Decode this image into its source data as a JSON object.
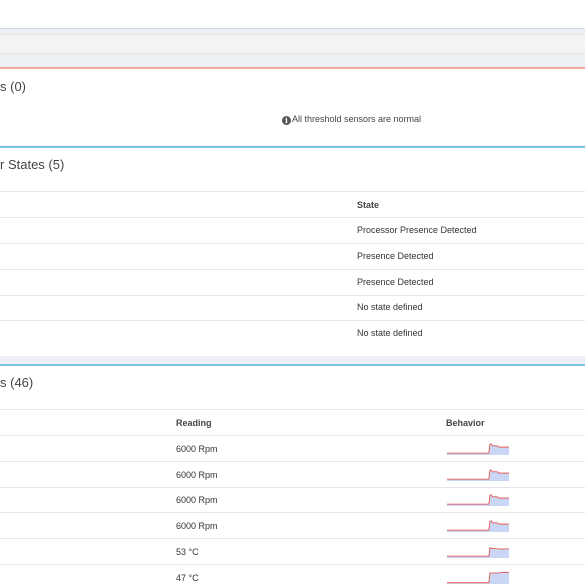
{
  "threshold_panel": {
    "title": "s (0)",
    "message": "All threshold sensors are normal"
  },
  "discrete_panel": {
    "title": "r States (5)",
    "columns": {
      "state": "State"
    },
    "rows": [
      {
        "state": "Processor Presence Detected"
      },
      {
        "state": "Presence Detected"
      },
      {
        "state": "Presence Detected"
      },
      {
        "state": "No state defined"
      },
      {
        "state": "No state defined"
      }
    ]
  },
  "sensor_panel": {
    "title": "s (46)",
    "columns": {
      "reading": "Reading",
      "behavior": "Behavior"
    },
    "rows": [
      {
        "reading": "6000 Rpm",
        "behavior": [
          0.15,
          0.15,
          0.15,
          0.15,
          0.15,
          0.15,
          0.15,
          0.15,
          0.15,
          0.15,
          0.15,
          0.15,
          0.15,
          0.15,
          0.15,
          0.15,
          0.15,
          0.15,
          0.15,
          0.15,
          0.15,
          0.15,
          0.15,
          0.15,
          0.15,
          0.15,
          0.15,
          0.15,
          0.15,
          0.15,
          0.15,
          0.15,
          0.15,
          0.15,
          0.85,
          0.85,
          0.7,
          0.7,
          0.72,
          0.7,
          0.7,
          0.6,
          0.62,
          0.6,
          0.6,
          0.62,
          0.6,
          0.6,
          0.62,
          0.6
        ]
      },
      {
        "reading": "6000 Rpm",
        "behavior": [
          0.15,
          0.15,
          0.15,
          0.15,
          0.15,
          0.15,
          0.15,
          0.15,
          0.15,
          0.15,
          0.15,
          0.15,
          0.15,
          0.15,
          0.15,
          0.15,
          0.15,
          0.15,
          0.15,
          0.15,
          0.15,
          0.15,
          0.15,
          0.15,
          0.15,
          0.15,
          0.15,
          0.15,
          0.15,
          0.15,
          0.15,
          0.15,
          0.15,
          0.15,
          0.85,
          0.85,
          0.7,
          0.7,
          0.72,
          0.7,
          0.7,
          0.6,
          0.62,
          0.6,
          0.6,
          0.62,
          0.6,
          0.6,
          0.62,
          0.6
        ]
      },
      {
        "reading": "6000 Rpm",
        "behavior": [
          0.15,
          0.15,
          0.15,
          0.15,
          0.15,
          0.15,
          0.15,
          0.15,
          0.15,
          0.15,
          0.15,
          0.15,
          0.15,
          0.15,
          0.15,
          0.15,
          0.15,
          0.15,
          0.15,
          0.15,
          0.15,
          0.15,
          0.15,
          0.15,
          0.15,
          0.15,
          0.15,
          0.15,
          0.15,
          0.15,
          0.15,
          0.15,
          0.15,
          0.15,
          0.85,
          0.85,
          0.7,
          0.7,
          0.72,
          0.7,
          0.7,
          0.6,
          0.62,
          0.6,
          0.6,
          0.62,
          0.6,
          0.6,
          0.62,
          0.6
        ]
      },
      {
        "reading": "6000 Rpm",
        "behavior": [
          0.15,
          0.15,
          0.15,
          0.15,
          0.15,
          0.15,
          0.15,
          0.15,
          0.15,
          0.15,
          0.15,
          0.15,
          0.15,
          0.15,
          0.15,
          0.15,
          0.15,
          0.15,
          0.15,
          0.15,
          0.15,
          0.15,
          0.15,
          0.15,
          0.15,
          0.15,
          0.15,
          0.15,
          0.15,
          0.15,
          0.15,
          0.15,
          0.15,
          0.15,
          0.85,
          0.85,
          0.7,
          0.7,
          0.72,
          0.7,
          0.7,
          0.6,
          0.62,
          0.6,
          0.6,
          0.62,
          0.6,
          0.6,
          0.62,
          0.6
        ]
      },
      {
        "reading": "53 °C",
        "behavior": [
          0.15,
          0.15,
          0.15,
          0.15,
          0.15,
          0.15,
          0.15,
          0.15,
          0.15,
          0.15,
          0.15,
          0.15,
          0.15,
          0.15,
          0.15,
          0.15,
          0.15,
          0.15,
          0.15,
          0.15,
          0.15,
          0.15,
          0.15,
          0.15,
          0.15,
          0.15,
          0.15,
          0.15,
          0.15,
          0.15,
          0.15,
          0.15,
          0.15,
          0.15,
          0.8,
          0.75,
          0.75,
          0.72,
          0.72,
          0.72,
          0.7,
          0.7,
          0.7,
          0.7,
          0.68,
          0.68,
          0.7,
          0.7,
          0.7,
          0.7
        ]
      },
      {
        "reading": "47 °C",
        "behavior": [
          0.1,
          0.1,
          0.1,
          0.1,
          0.1,
          0.1,
          0.1,
          0.1,
          0.1,
          0.1,
          0.1,
          0.1,
          0.1,
          0.1,
          0.1,
          0.1,
          0.1,
          0.1,
          0.1,
          0.1,
          0.1,
          0.1,
          0.1,
          0.1,
          0.1,
          0.1,
          0.1,
          0.1,
          0.1,
          0.1,
          0.1,
          0.1,
          0.1,
          0.1,
          0.85,
          0.85,
          0.85,
          0.85,
          0.85,
          0.85,
          0.85,
          0.85,
          0.88,
          0.88,
          0.88,
          0.88,
          0.9,
          0.9,
          0.9,
          0.9
        ]
      }
    ]
  },
  "colors": {
    "danger_border": "#f3a99c",
    "info_border": "#7cc3ea",
    "spark_fill": "#c9d6f5",
    "spark_line": "#e8473b"
  }
}
